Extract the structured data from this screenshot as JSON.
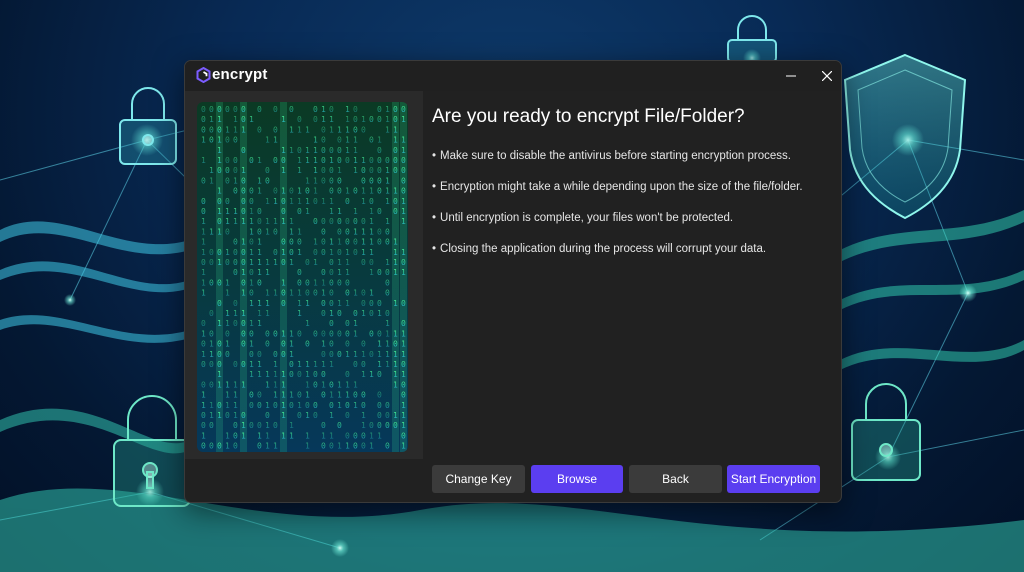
{
  "window": {
    "app_name": "encrypt",
    "controls": {
      "minimize_icon": "minimize-icon",
      "close_icon": "close-icon"
    }
  },
  "content": {
    "heading": "Are you ready to encrypt File/Folder?",
    "bullets": [
      "Make sure to disable the antivirus before starting encryption process.",
      "Encryption might take a while depending upon the size of the file/folder.",
      "Until encryption is complete, your files won't be protected.",
      "Closing the application during the process will corrupt your data."
    ]
  },
  "buttons": {
    "change_key": "Change Key",
    "browse": "Browse",
    "back": "Back",
    "start_encryption": "Start Encryption"
  },
  "colors": {
    "accent": "#5b3ef0",
    "window_bg": "#212121",
    "panel_bg": "#2a2a2a",
    "button_gray": "#3b3b3b"
  },
  "icons": {
    "app_logo": "encrypt-logo-icon",
    "background_locks": "padlock-icon",
    "background_shield": "shield-icon"
  }
}
